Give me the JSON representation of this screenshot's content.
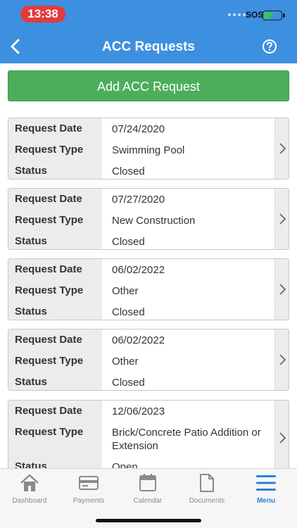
{
  "status_bar": {
    "time": "13:38",
    "carrier": "SOS"
  },
  "nav": {
    "title": "ACC Requests",
    "back_icon": "chevron-left-icon",
    "help_icon": "help-circle-icon"
  },
  "add_button": {
    "label": "Add ACC Request"
  },
  "labels": {
    "request_date": "Request Date",
    "request_type": "Request Type",
    "status": "Status"
  },
  "requests": [
    {
      "date": "07/24/2020",
      "type": "Swimming Pool",
      "status": "Closed"
    },
    {
      "date": "07/27/2020",
      "type": "New Construction",
      "status": "Closed"
    },
    {
      "date": "06/02/2022",
      "type": "Other",
      "status": "Closed"
    },
    {
      "date": "06/02/2022",
      "type": "Other",
      "status": "Closed"
    },
    {
      "date": "12/06/2023",
      "type": "Brick/Concrete Patio Addition or Extension",
      "status": "Open"
    }
  ],
  "tabs": [
    {
      "label": "Dashboard",
      "icon": "home-icon",
      "active": false
    },
    {
      "label": "Payments",
      "icon": "credit-card-icon",
      "active": false
    },
    {
      "label": "Calendar",
      "icon": "calendar-icon",
      "active": false
    },
    {
      "label": "Documents",
      "icon": "document-icon",
      "active": false
    },
    {
      "label": "Menu",
      "icon": "menu-icon",
      "active": true
    }
  ],
  "colors": {
    "header": "#3d8fe0",
    "add_button": "#4cae5b",
    "active_tab": "#2f7fd6",
    "time_pill": "#e23c3c"
  }
}
